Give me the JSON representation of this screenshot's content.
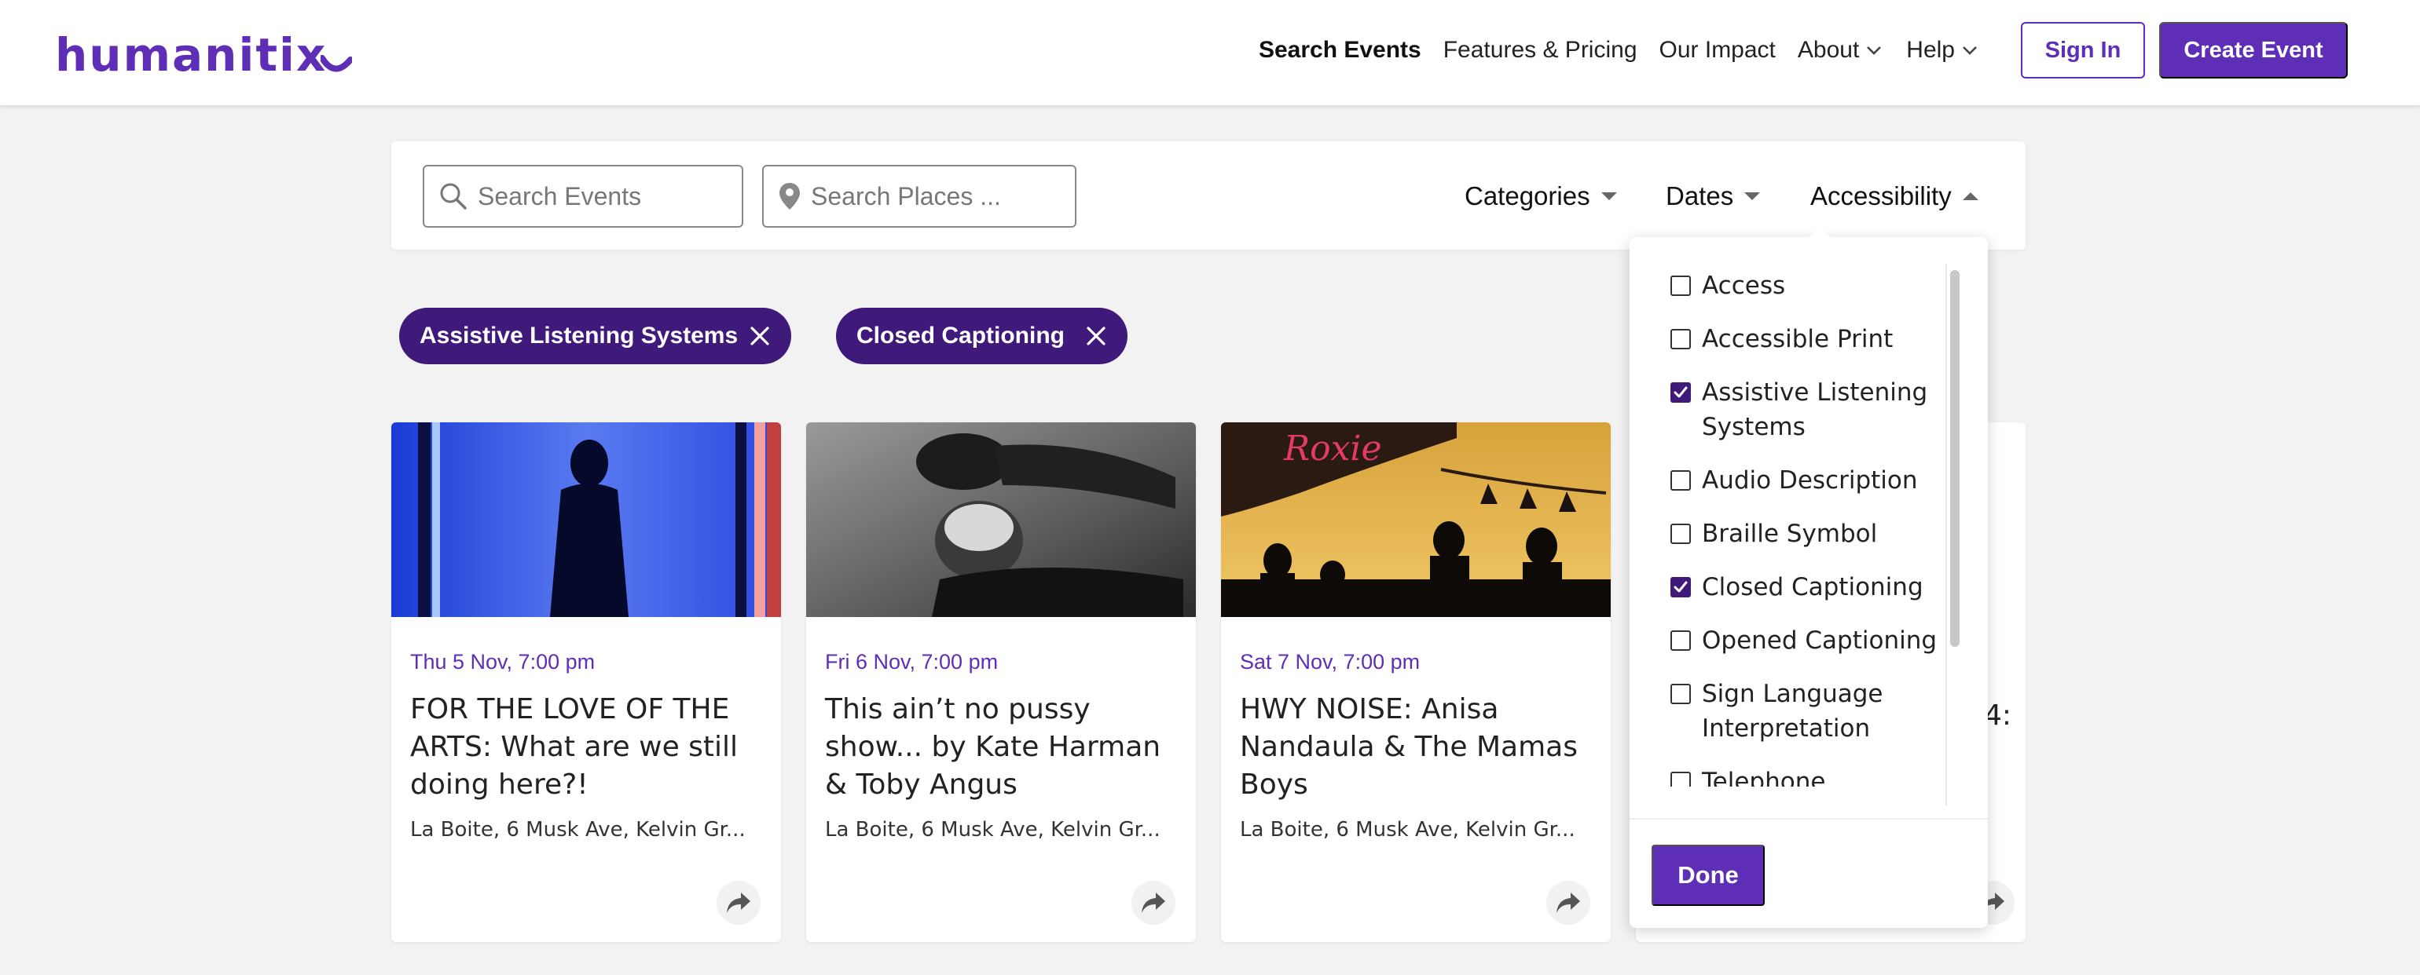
{
  "header": {
    "logo": "humanitix",
    "nav": [
      {
        "label": "Search Events",
        "active": true,
        "dropdown": false
      },
      {
        "label": "Features & Pricing",
        "active": false,
        "dropdown": false
      },
      {
        "label": "Our Impact",
        "active": false,
        "dropdown": false
      },
      {
        "label": "About",
        "active": false,
        "dropdown": true
      },
      {
        "label": "Help",
        "active": false,
        "dropdown": true
      }
    ],
    "sign_in": "Sign In",
    "create_event": "Create Event"
  },
  "search": {
    "events_placeholder": "Search Events",
    "places_placeholder": "Search Places ...",
    "filters": [
      "Categories",
      "Dates",
      "Accessibility"
    ]
  },
  "chips": [
    {
      "label": "Assistive Listening Systems"
    },
    {
      "label": "Closed Captioning"
    }
  ],
  "cards": [
    {
      "date": "Thu 5 Nov, 7:00 pm",
      "title": "FOR THE LOVE OF THE ARTS: What are we still doing here?!",
      "venue": "La Boite, 6 Musk Ave, Kelvin Gr..."
    },
    {
      "date": "Fri 6 Nov, 7:00 pm",
      "title": "This ain’t no pussy show... by Kate Harman & Toby Angus",
      "venue": "La Boite, 6 Musk Ave, Kelvin Gr..."
    },
    {
      "date": "Sat 7 Nov, 7:00 pm",
      "title": "HWY NOISE: Anisa Nandaula & The Mamas Boys",
      "venue": "La Boite, 6 Musk Ave, Kelvin Gr..."
    }
  ],
  "card4_partial_title": "4:",
  "image_sign_text": "Roxie",
  "accessibility": {
    "options": [
      {
        "label": "Access",
        "checked": false
      },
      {
        "label": "Accessible Print",
        "checked": false
      },
      {
        "label": "Assistive Listening Systems",
        "checked": true
      },
      {
        "label": "Audio Description",
        "checked": false
      },
      {
        "label": "Braille Symbol",
        "checked": false
      },
      {
        "label": "Closed Captioning",
        "checked": true
      },
      {
        "label": "Opened Captioning",
        "checked": false
      },
      {
        "label": "Sign Language Interpretation",
        "checked": false
      },
      {
        "label": "Telephone",
        "checked": false
      }
    ],
    "done": "Done"
  },
  "colors": {
    "brand": "#5f2eb6",
    "chip": "#3f1a7a",
    "background": "#f2f2f2"
  }
}
